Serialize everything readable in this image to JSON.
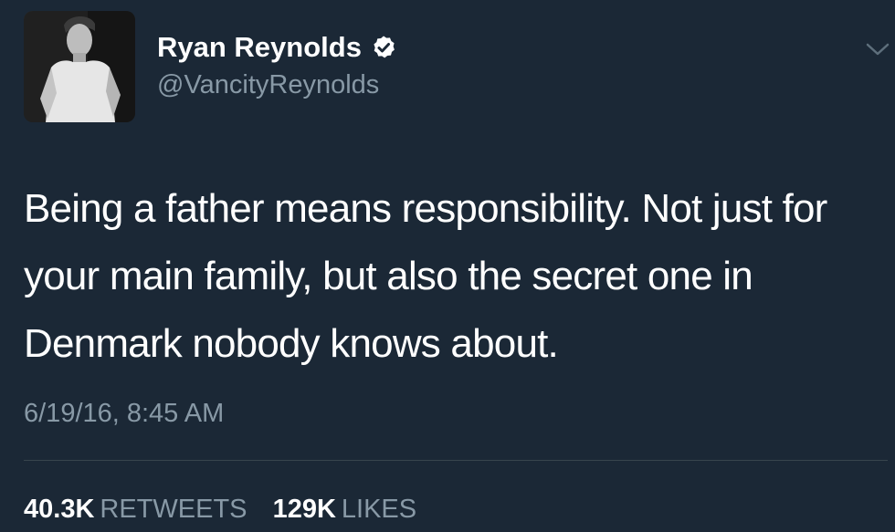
{
  "user": {
    "display_name": "Ryan Reynolds",
    "handle": "@VancityReynolds",
    "verified": true,
    "avatar_icon": "profile-photo"
  },
  "tweet": {
    "text": "Being a father means responsibility. Not just for your main family, but also the secret one in Denmark nobody knows about.",
    "timestamp": "6/19/16, 8:45 AM"
  },
  "stats": {
    "retweets_count": "40.3K",
    "retweets_label": "RETWEETS",
    "likes_count": "129K",
    "likes_label": "LIKES"
  },
  "colors": {
    "background": "#1b2836",
    "primary_text": "#ffffff",
    "secondary_text": "#8899a6",
    "divider": "#38444d"
  },
  "icons": {
    "verified": "verified-badge-icon",
    "menu": "chevron-down-icon"
  }
}
